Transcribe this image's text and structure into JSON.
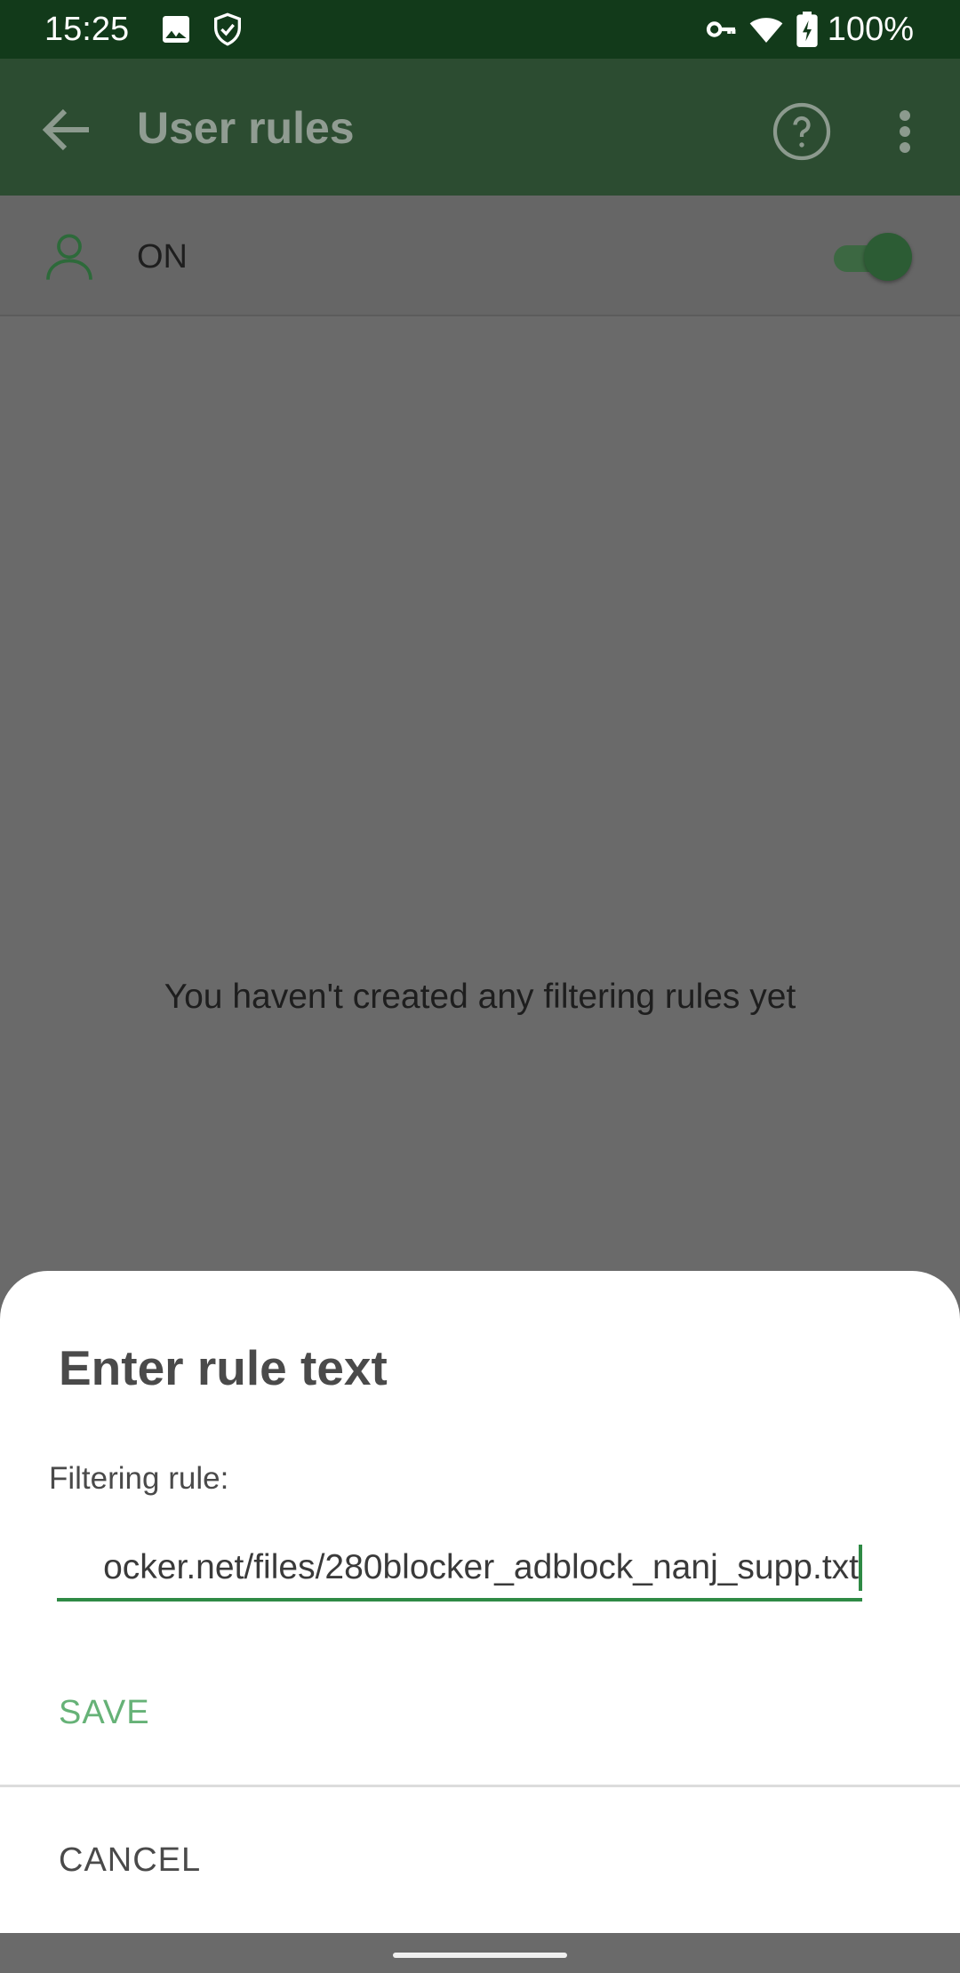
{
  "status_bar": {
    "time": "15:25",
    "battery": "100%",
    "icons": [
      "image-icon",
      "shield-check-icon",
      "vpn-key-icon",
      "wifi-icon",
      "battery-charging-icon"
    ]
  },
  "app_bar": {
    "title": "User rules",
    "icons": [
      "back-arrow-icon",
      "help-icon",
      "more-vertical-icon"
    ]
  },
  "toggle_row": {
    "label": "ON",
    "enabled": true,
    "icon": "user-icon"
  },
  "empty_state": {
    "message": "You haven't created any filtering rules yet"
  },
  "dialog": {
    "title": "Enter rule text",
    "field_label": "Filtering rule:",
    "field_value": "ocker.net/files/280blocker_adblock_nanj_supp.txt",
    "save_label": "SAVE",
    "cancel_label": "CANCEL"
  },
  "colors": {
    "status_bar": "#123a1a",
    "app_bar_dimmed": "#2c4c31",
    "accent": "#2f8a45",
    "save_text": "#66b277",
    "scrim": "#6a6a6a"
  }
}
